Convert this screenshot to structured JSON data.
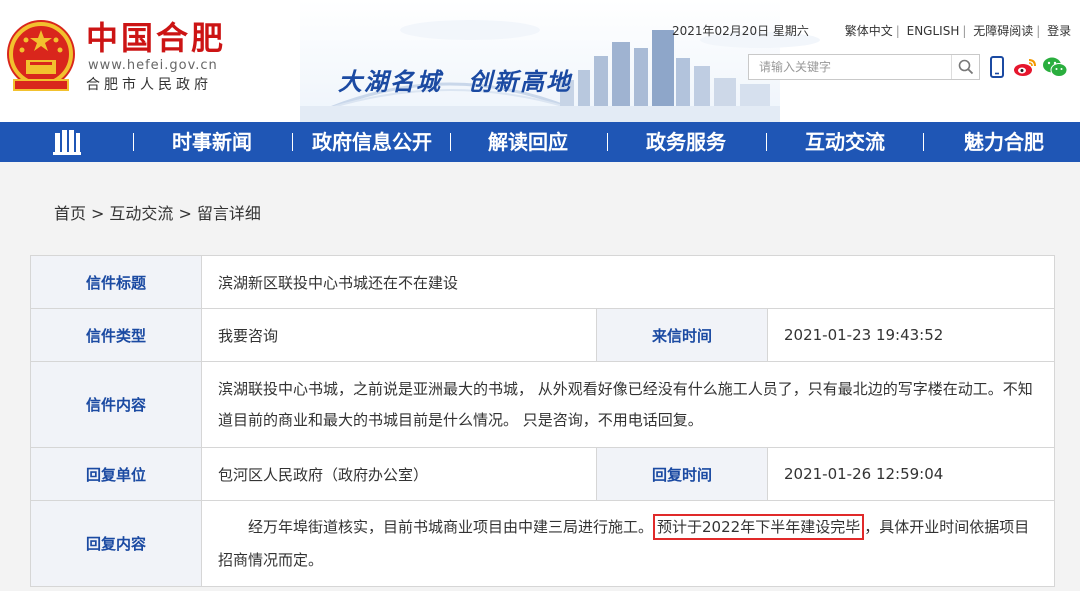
{
  "header": {
    "logo_main": "中国合肥",
    "logo_url": "www.hefei.gov.cn",
    "logo_sub": "合肥市人民政府",
    "slogan": "大湖名城　创新高地"
  },
  "topbar": {
    "date": "2021年02月20日 星期六",
    "links": [
      "繁体中文",
      "ENGLISH",
      "无障碍阅读",
      "登录"
    ]
  },
  "search": {
    "placeholder": "请输入关键字"
  },
  "icons": {
    "search": "search-icon",
    "mobile": "mobile-icon",
    "weibo": "weibo-icon",
    "wechat": "wechat-icon",
    "home": "building-icon"
  },
  "colors": {
    "nav_bg": "#1f56b5",
    "label_text": "#1b4aa2",
    "label_bg": "#f1f3f8",
    "logo_red": "#cc1414",
    "highlight_border": "#e02a2a"
  },
  "nav": {
    "items": [
      "时事新闻",
      "政府信息公开",
      "解读回应",
      "政务服务",
      "互动交流",
      "魅力合肥"
    ]
  },
  "breadcrumb": {
    "items": [
      "首页",
      "互动交流",
      "留言详细"
    ],
    "separator": ">"
  },
  "letter": {
    "title_label": "信件标题",
    "title": "滨湖新区联投中心书城还在不在建设",
    "type_label": "信件类型",
    "type": "我要咨询",
    "time_label": "来信时间",
    "time": "2021-01-23 19:43:52",
    "content_label": "信件内容",
    "content": "滨湖联投中心书城，之前说是亚洲最大的书城， 从外观看好像已经没有什么施工人员了，只有最北边的写字楼在动工。不知道目前的商业和最大的书城目前是什么情况。 只是咨询，不用电话回复。",
    "reply_unit_label": "回复单位",
    "reply_unit": "包河区人民政府（政府办公室）",
    "reply_time_label": "回复时间",
    "reply_time": "2021-01-26 12:59:04",
    "reply_content_label": "回复内容",
    "reply_part1": "经万年埠街道核实，目前书城商业项目由中建三局进行施工。",
    "reply_highlight": "预计于2022年下半年建设完毕",
    "reply_part2": "，具体开业时间依据项目招商情况而定。"
  }
}
